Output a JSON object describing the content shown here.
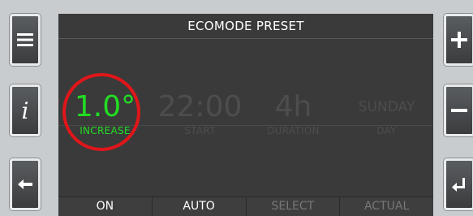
{
  "title": "ECOMODE PRESET",
  "fields": [
    {
      "value": "1.0°",
      "label": "INCREASE",
      "active": true
    },
    {
      "value": "22:00",
      "label": "START",
      "active": false
    },
    {
      "value": "4h",
      "label": "DURATION",
      "active": false
    },
    {
      "value": "SUNDAY",
      "label": "DAY",
      "active": false
    }
  ],
  "softkeys": [
    "ON",
    "AUTO",
    "SELECT",
    "ACTUAL"
  ],
  "side_buttons": {
    "left": [
      "menu-icon",
      "info-icon",
      "back-arrow-icon"
    ],
    "right": [
      "plus-icon",
      "minus-icon",
      "enter-icon"
    ],
    "info_glyph": "i"
  },
  "colors": {
    "active": "#22dd22",
    "highlight_ring": "#e0161a",
    "screen": "#3a3a3a"
  }
}
